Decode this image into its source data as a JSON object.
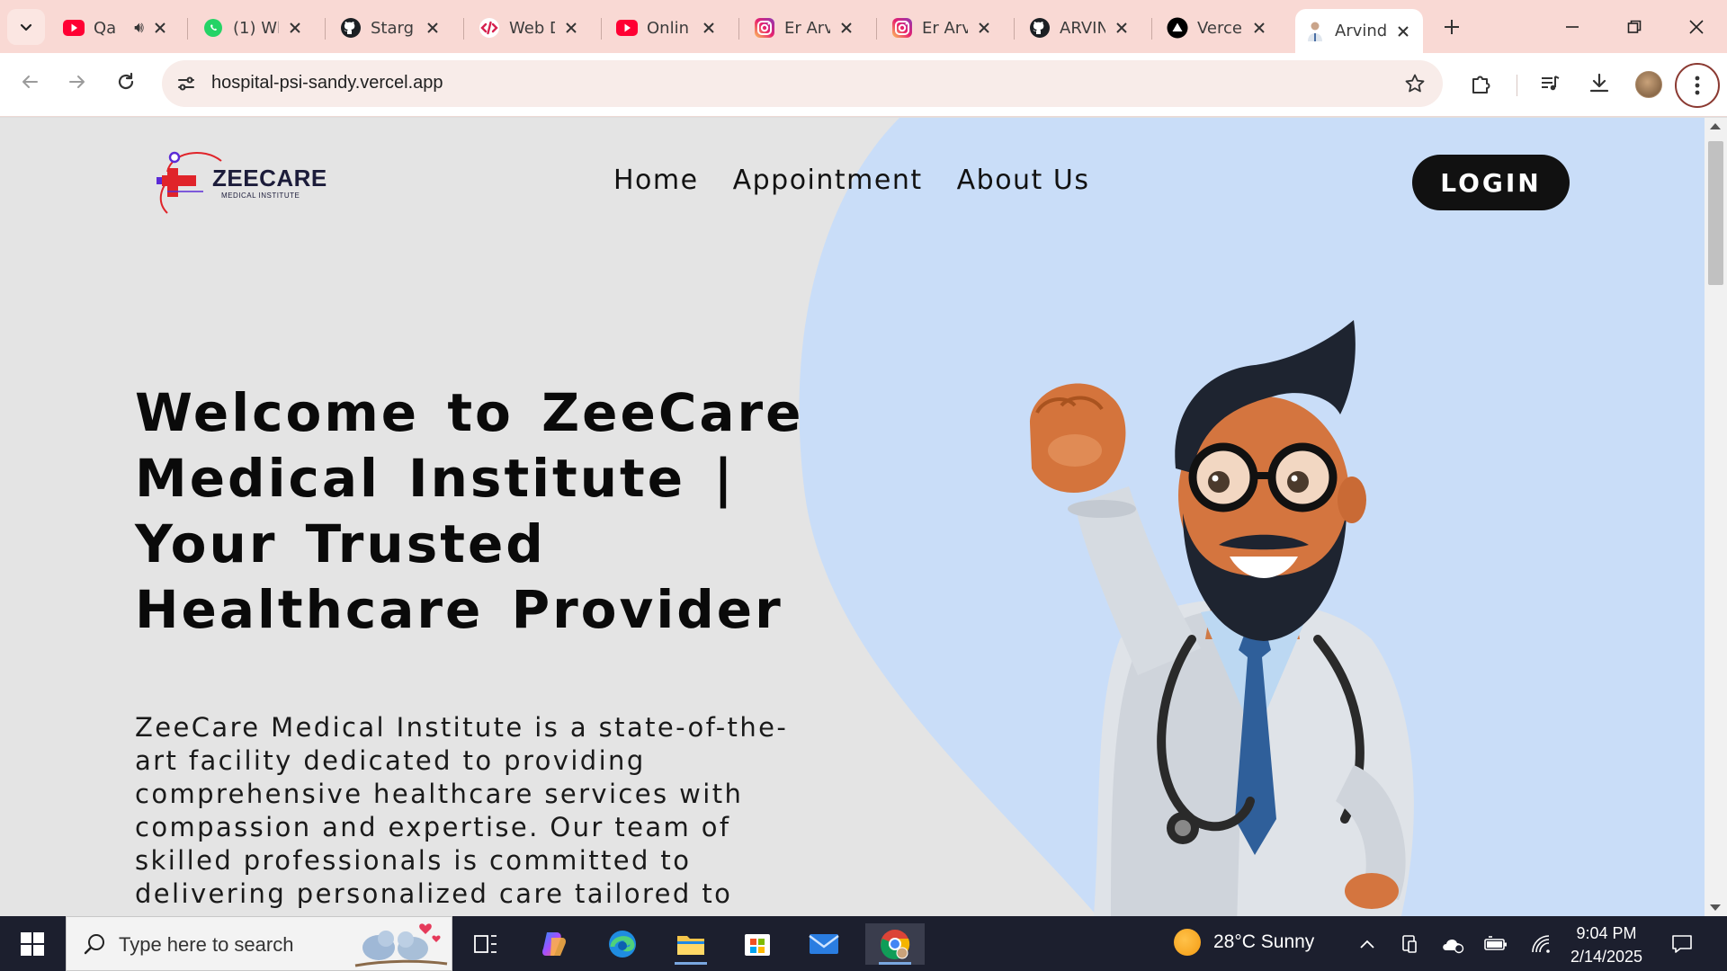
{
  "browser": {
    "tabs": [
      {
        "title": "Qa",
        "favicon": "youtube-icon",
        "audio": true
      },
      {
        "title": "(1) Wl",
        "favicon": "whatsapp-icon"
      },
      {
        "title": "Starg",
        "favicon": "github-icon"
      },
      {
        "title": "Web D",
        "favicon": "code-icon"
      },
      {
        "title": "Onlin",
        "favicon": "youtube-icon"
      },
      {
        "title": "Er Arv",
        "favicon": "instagram-icon"
      },
      {
        "title": "Er Arv",
        "favicon": "instagram-icon"
      },
      {
        "title": "ARVIN",
        "favicon": "github-icon"
      },
      {
        "title": "Vercel",
        "favicon": "vercel-icon"
      },
      {
        "title": "Arvind",
        "favicon": "doctor-icon",
        "active": true
      }
    ],
    "url": "hospital-psi-sandy.vercel.app"
  },
  "site": {
    "logo_text": "ZEECARE",
    "logo_subtext": "MEDICAL INSTITUTE",
    "nav": [
      "Home",
      "Appointment",
      "About Us"
    ],
    "login_label": "LOGIN",
    "hero_title": "Welcome to ZeeCare Medical Institute | Your Trusted Healthcare Provider",
    "hero_description": "ZeeCare Medical Institute is a state-of-the-art facility dedicated to providing comprehensive healthcare services with compassion and expertise. Our team of skilled professionals is committed to delivering personalized care tailored to",
    "colors": {
      "accent_blob": "#c8dcf8",
      "page_bg": "#e4e4e4",
      "login_bg": "#111111",
      "logo_red": "#e0242a",
      "logo_purple": "#5b2bd6"
    }
  },
  "taskbar": {
    "search_placeholder": "Type here to search",
    "weather": "28°C  Sunny",
    "time": "9:04 PM",
    "date": "2/14/2025",
    "apps": [
      "task-view-icon",
      "copilot-icon",
      "edge-icon",
      "file-explorer-icon",
      "microsoft-store-icon",
      "mail-icon",
      "chrome-icon"
    ]
  }
}
